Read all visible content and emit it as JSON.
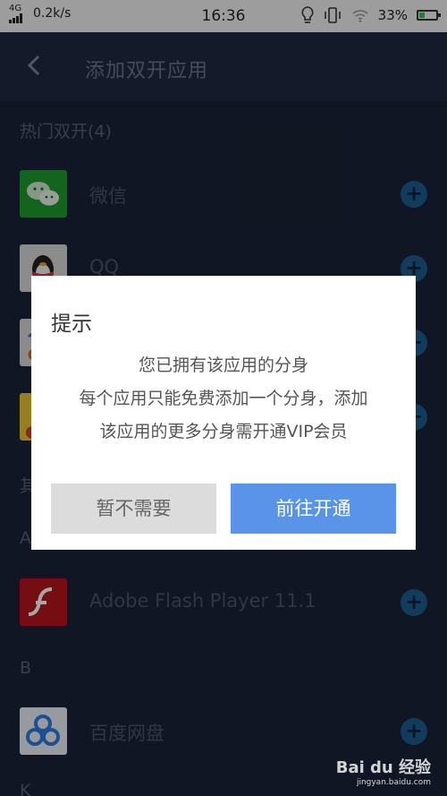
{
  "status_bar": {
    "network": "4G",
    "speed": "0.2k/s",
    "time": "16:36",
    "battery": "33%",
    "battery_level": 0.33
  },
  "header": {
    "title": "添加双开应用"
  },
  "sections": {
    "hot_title": "热门双开(4)",
    "other_partial": "其",
    "letter_a": "A",
    "letter_b": "B",
    "letter_k": "K"
  },
  "apps": {
    "wechat": "微信",
    "qq": "QQ",
    "flash": "Adobe Flash Player 11.1",
    "baidu_pan": "百度网盘"
  },
  "dialog": {
    "title": "提示",
    "line1": "您已拥有该应用的分身",
    "line2": "每个应用只能免费添加一个分身，添加",
    "line3": "该应用的更多分身需开通VIP会员",
    "cancel_label": "暂不需要",
    "ok_label": "前往开通"
  },
  "watermark": {
    "brand": "Bai du 经验",
    "url": "jingyan.baidu.com"
  },
  "colors": {
    "accent": "#5a94e8",
    "background": "#1a2236",
    "add_button": "#1d5d8c"
  }
}
